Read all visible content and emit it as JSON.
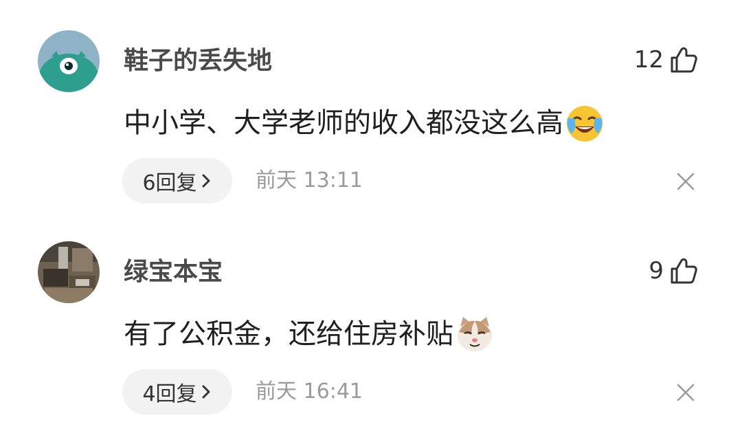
{
  "comments": [
    {
      "username": "鞋子的丢失地",
      "likes": "12",
      "text": "中小学、大学老师的收入都没这么高",
      "emoji": "crying-laughing-emoji",
      "reply_label": "6回复",
      "timestamp": "前天 13:11"
    },
    {
      "username": "绿宝本宝",
      "likes": "9",
      "text": "有了公积金，还给住房补贴",
      "emoji": "cat-face-emoji",
      "reply_label": "4回复",
      "timestamp": "前天 16:41"
    }
  ],
  "colors": {
    "avatar1_bg": "#8fb3c6",
    "avatar1_creature": "#2e9e8f",
    "reply_bg": "#f2f2f2",
    "meta_gray": "#9a9a9a"
  },
  "icons": {
    "like": "thumbs-up-outline-icon",
    "chevron": "chevron-right-icon",
    "close": "close-icon"
  }
}
